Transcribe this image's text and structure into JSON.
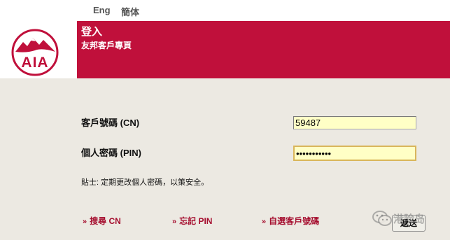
{
  "languages": {
    "english": "Eng",
    "simplified": "簡体"
  },
  "banner": {
    "title": "登入",
    "subtitle": "友邦客戶專頁"
  },
  "form": {
    "customer_no": {
      "label": "客戶號碼 (CN)",
      "value": "59487"
    },
    "pin": {
      "label": "個人密碼 (PIN)",
      "value": "•••••••••••"
    }
  },
  "tip": "貼士: 定期更改個人密碼，以策安全。",
  "links": {
    "search_cn": {
      "arrow": "»",
      "label": "搜尋 CN"
    },
    "forgot_pin": {
      "arrow": "»",
      "label": "忘記 PIN"
    },
    "choose_cn": {
      "arrow": "»",
      "label": "自選客戶號碼"
    }
  },
  "submit_label": "遞送",
  "watermark": "港险岛",
  "colors": {
    "brand_red": "#c0103b",
    "link_red": "#a50d2e",
    "input_bg": "#ffffc6",
    "page_bg": "#ece9e2"
  }
}
